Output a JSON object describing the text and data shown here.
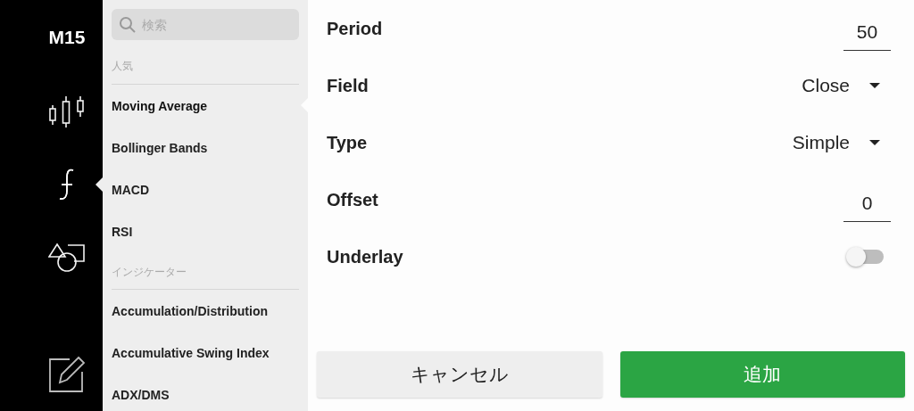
{
  "rail": {
    "timeframe": "M15",
    "tools": [
      {
        "kind": "candles",
        "selected": false
      },
      {
        "kind": "function",
        "selected": true
      },
      {
        "kind": "shapes",
        "selected": false
      }
    ],
    "bottom_tool": {
      "kind": "edit"
    }
  },
  "indicator_list": {
    "search": {
      "placeholder": "検索"
    },
    "sections": [
      {
        "title": "人気",
        "items": [
          {
            "label": "Moving Average",
            "selected": true
          },
          {
            "label": "Bollinger Bands",
            "selected": false
          },
          {
            "label": "MACD",
            "selected": false
          },
          {
            "label": "RSI",
            "selected": false
          }
        ]
      },
      {
        "title": "インジケーター",
        "items": [
          {
            "label": "Accumulation/Distribution",
            "selected": false
          },
          {
            "label": "Accumulative Swing Index",
            "selected": false
          },
          {
            "label": "ADX/DMS",
            "selected": false
          }
        ]
      }
    ]
  },
  "settings": [
    {
      "kind": "number",
      "label": "Period",
      "value": "50"
    },
    {
      "kind": "select",
      "label": "Field",
      "value": "Close"
    },
    {
      "kind": "select",
      "label": "Type",
      "value": "Simple"
    },
    {
      "kind": "number",
      "label": "Offset",
      "value": "0"
    },
    {
      "kind": "toggle",
      "label": "Underlay",
      "on": false
    }
  ],
  "buttons": [
    {
      "kind": "secondary",
      "label": "キャンセル"
    },
    {
      "kind": "primary",
      "label": "追加"
    }
  ]
}
